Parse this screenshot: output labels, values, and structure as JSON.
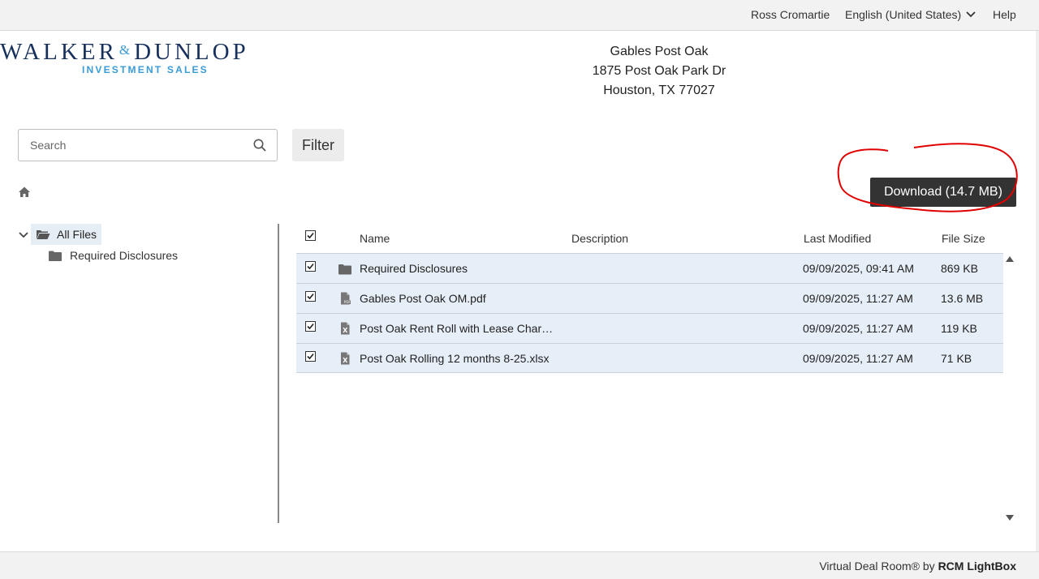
{
  "topbar": {
    "user": "Ross Cromartie",
    "language": "English (United States)",
    "help": "Help"
  },
  "logo": {
    "name_left": "WALKER",
    "amp": "&",
    "name_right": "DUNLOP",
    "sub": "INVESTMENT SALES"
  },
  "property": {
    "name": "Gables Post Oak",
    "street": "1875 Post Oak Park Dr",
    "city": "Houston, TX 77027"
  },
  "search": {
    "placeholder": "Search",
    "value": ""
  },
  "filter_label": "Filter",
  "download_label": "Download (14.7 MB)",
  "tree": {
    "root": "All Files",
    "children": [
      "Required Disclosures"
    ]
  },
  "table": {
    "headers": {
      "name": "Name",
      "description": "Description",
      "modified": "Last Modified",
      "size": "File Size"
    },
    "rows": [
      {
        "checked": true,
        "icon": "folder-icon",
        "name": "Required Disclosures",
        "description": "",
        "modified": "09/09/2025, 09:41 AM",
        "size": "869 KB"
      },
      {
        "checked": true,
        "icon": "pdf-file-icon",
        "name": "Gables Post Oak OM.pdf",
        "description": "",
        "modified": "09/09/2025, 11:27 AM",
        "size": "13.6 MB"
      },
      {
        "checked": true,
        "icon": "excel-file-icon",
        "name": "Post Oak Rent Roll with Lease Char…",
        "description": "",
        "modified": "09/09/2025, 11:27 AM",
        "size": "119 KB"
      },
      {
        "checked": true,
        "icon": "excel-file-icon",
        "name": "Post Oak Rolling 12 months 8-25.xlsx",
        "description": "",
        "modified": "09/09/2025, 11:27 AM",
        "size": "71 KB"
      }
    ]
  },
  "footer": {
    "prefix": "Virtual Deal Room® by ",
    "brand": "RCM LightBox"
  },
  "colors": {
    "brand_navy": "#17305c",
    "brand_blue": "#3a9bd5",
    "row_selected": "#e6eef7",
    "annotation_red": "#e00000"
  }
}
